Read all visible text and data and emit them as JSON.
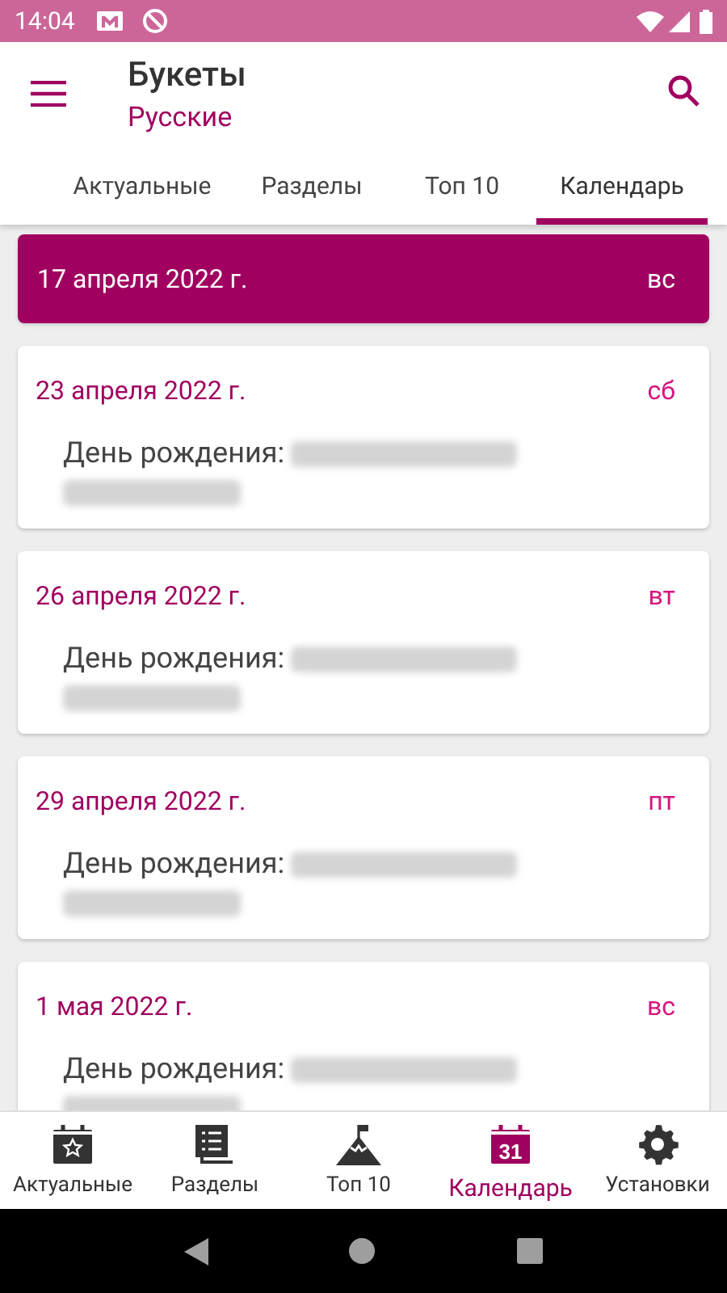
{
  "status_bar": {
    "time": "14:04"
  },
  "app_bar": {
    "title": "Букеты",
    "subtitle": "Русские"
  },
  "tabs": [
    {
      "label": "Актуальные",
      "selected": false
    },
    {
      "label": "Разделы",
      "selected": false
    },
    {
      "label": "Топ 10",
      "selected": false
    },
    {
      "label": "Календарь",
      "selected": true
    }
  ],
  "days": [
    {
      "kind": "today",
      "date": "17 апреля 2022 г.",
      "weekday": "вс"
    },
    {
      "kind": "event",
      "date": "23 апреля 2022 г.",
      "weekday": "сб",
      "event": "День рождения:"
    },
    {
      "kind": "event",
      "date": "26 апреля 2022 г.",
      "weekday": "вт",
      "event": "День рождения:"
    },
    {
      "kind": "event",
      "date": "29 апреля 2022 г.",
      "weekday": "пт",
      "event": "День рождения:"
    },
    {
      "kind": "event",
      "date": "1 мая 2022 г.",
      "weekday": "вс",
      "event": "День рождения:"
    }
  ],
  "bottom_nav": [
    {
      "kind": "star-calendar",
      "label": "Актуальные",
      "selected": false
    },
    {
      "kind": "list",
      "label": "Разделы",
      "selected": false
    },
    {
      "kind": "mountain",
      "label": "Топ 10",
      "selected": false
    },
    {
      "kind": "calendar",
      "label": "Календарь",
      "selected": true,
      "badge": "31"
    },
    {
      "kind": "gear",
      "label": "Установки",
      "selected": false
    }
  ]
}
